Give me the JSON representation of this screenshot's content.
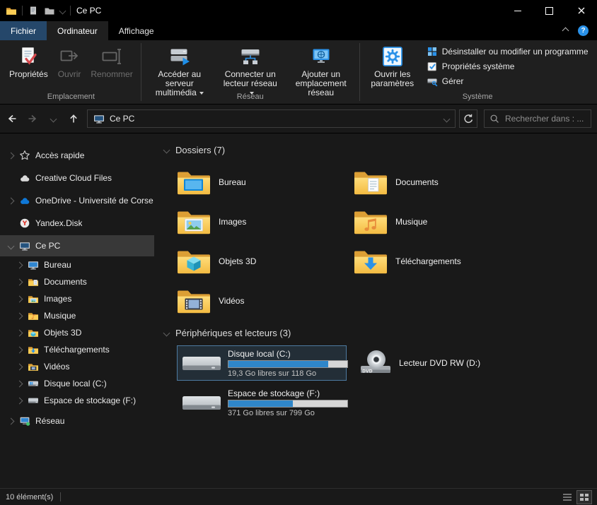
{
  "titlebar": {
    "title": "Ce PC"
  },
  "tabs": {
    "items": [
      {
        "label": "Fichier"
      },
      {
        "label": "Ordinateur"
      },
      {
        "label": "Affichage"
      }
    ],
    "help_glyph": "?"
  },
  "ribbon": {
    "groups": [
      {
        "label": "Emplacement",
        "buttons": [
          {
            "label": "Propriétés"
          },
          {
            "label": "Ouvrir"
          },
          {
            "label": "Renommer"
          }
        ]
      },
      {
        "label": "Réseau",
        "buttons": [
          {
            "label": "Accéder au serveur multimédia"
          },
          {
            "label": "Connecter un lecteur réseau"
          },
          {
            "label": "Ajouter un emplacement réseau"
          }
        ]
      },
      {
        "label": "Système",
        "big_button": {
          "label": "Ouvrir les paramètres"
        },
        "small_buttons": [
          {
            "label": "Désinstaller ou modifier un programme"
          },
          {
            "label": "Propriétés système"
          },
          {
            "label": "Gérer"
          }
        ]
      }
    ]
  },
  "addressbar": {
    "location": "Ce PC",
    "search_placeholder": "Rechercher dans : ..."
  },
  "sidebar": {
    "items": [
      {
        "label": "Accès rapide"
      },
      {
        "label": "Creative Cloud Files"
      },
      {
        "label": "OneDrive - Université de Corse"
      },
      {
        "label": "Yandex.Disk"
      },
      {
        "label": "Ce PC"
      },
      {
        "label": "Bureau"
      },
      {
        "label": "Documents"
      },
      {
        "label": "Images"
      },
      {
        "label": "Musique"
      },
      {
        "label": "Objets 3D"
      },
      {
        "label": "Téléchargements"
      },
      {
        "label": "Vidéos"
      },
      {
        "label": "Disque local (C:)"
      },
      {
        "label": "Espace de stockage (F:)"
      },
      {
        "label": "Réseau"
      }
    ],
    "yandex_glyph": "Y"
  },
  "content": {
    "folders_section_title": "Dossiers (7)",
    "folders": [
      {
        "name": "Bureau"
      },
      {
        "name": "Documents"
      },
      {
        "name": "Images"
      },
      {
        "name": "Musique"
      },
      {
        "name": "Objets 3D"
      },
      {
        "name": "Téléchargements"
      },
      {
        "name": "Vidéos"
      }
    ],
    "drives_section_title": "Périphériques et lecteurs (3)",
    "drives": [
      {
        "name": "Disque local (C:)",
        "free_text": "19,3 Go libres sur 118 Go",
        "used_pct": 84
      },
      {
        "name": "Lecteur DVD RW (D:)",
        "icon_text": "DVD"
      },
      {
        "name": "Espace de stockage (F:)",
        "free_text": "371 Go libres sur 799 Go",
        "used_pct": 54
      }
    ]
  },
  "statusbar": {
    "count": "10 élément(s)"
  },
  "colors": {
    "accent_blue": "#2a91e8",
    "file_tab_blue": "#25476a",
    "bar_fill_blue": "#2f86c9"
  }
}
